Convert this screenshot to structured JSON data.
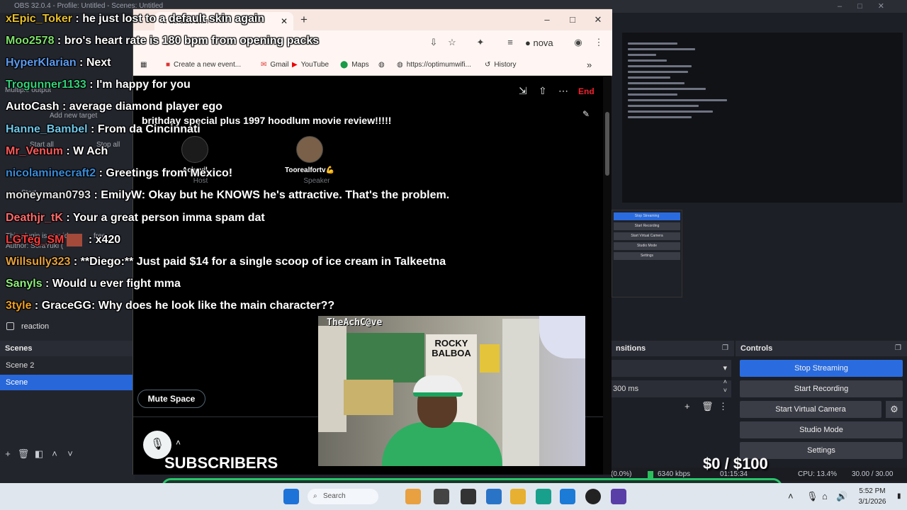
{
  "obs": {
    "title_bar": "OBS 32.0.4 - Profile: Untitled - Scenes: Untitled",
    "scenes_header": "Scenes",
    "scenes": [
      "Scene 2",
      "Scene"
    ],
    "active_scene": "Scene",
    "transitions_header": "nsitions",
    "transition_duration": "300 ms",
    "controls_header": "Controls",
    "controls": [
      "Stop Streaming",
      "Start Recording",
      "Start Virtual Camera",
      "Studio Mode",
      "Settings"
    ],
    "source_reaction": "reaction",
    "status": {
      "dropped": "(0.0%)",
      "bitrate": "6340 kbps",
      "time": "01:15:34",
      "cpu": "CPU: 13.4%",
      "fps": "30.00 / 30.00 FPS"
    },
    "ghost_texts": {
      "multiple_output": "Multiple output",
      "add_new_target": "Add new target",
      "start_all": "Start all",
      "stop_all": "Stop all",
      "plugin_notice": "This plugin is provide",
      "author": "Author: SoraYuki (",
      "free": "free",
      "host_label": "Host",
      "start": "Start"
    },
    "mini_controls": [
      "Stop Streaming",
      "Start Recording",
      "Start Virtual Camera",
      "Studio Mode",
      "Settings"
    ]
  },
  "browser": {
    "tab_title": "x  default skin",
    "bookmarks": [
      {
        "icon": "calendar-icon",
        "label": "Create a new event..."
      },
      {
        "icon": "gmail-icon",
        "label": "Gmail"
      },
      {
        "icon": "youtube-icon",
        "label": "YouTube"
      },
      {
        "icon": "maps-icon",
        "label": "Maps"
      },
      {
        "icon": "globe-icon",
        "label": ""
      },
      {
        "icon": "globe-icon",
        "label": "https://optimumwifi..."
      },
      {
        "icon": "history-icon",
        "label": "History"
      }
    ],
    "profile_name": "nova",
    "space": {
      "title": "brithday special plus 1997 hoodlum movie review!!!!!",
      "end_label": "End",
      "host_name": "Achavil",
      "host_role": "Host",
      "speaker_name": "Toorealfortv💪",
      "speaker_role": "Speaker",
      "mute_label": "Mute Space"
    }
  },
  "chat": [
    {
      "user": "xEpic_Toker",
      "color": "#e8c02a",
      "text": " : he just lost to a default skin again"
    },
    {
      "user": "Moo2578",
      "color": "#7ee06a",
      "text": " : bro's heart rate is 180 bpm from opening packs"
    },
    {
      "user": "HyperKlarian",
      "color": "#5b9bf0",
      "text": " : Next"
    },
    {
      "user": "Trogunner1133",
      "color": "#33d17a",
      "text": " : I'm happy for you"
    },
    {
      "user": "AutoCash",
      "color": "#ffffff",
      "text": " : average diamond player ego"
    },
    {
      "user": "Hanne_Bambel",
      "color": "#6fc7e8",
      "text": " : From da Cincinnati"
    },
    {
      "user": "Mr_Venum",
      "color": "#ff5a5a",
      "text": " : W Ach"
    },
    {
      "user": "nicolaminecraft2",
      "color": "#3a8bd8",
      "text": " : Greetings from Mexico!"
    },
    {
      "user": "moneyman0793",
      "color": "#e0e0e0",
      "text": " : EmilyW: Okay but he KNOWS he's attractive. That's the problem."
    },
    {
      "user": "Deathjr_tK",
      "color": "#ff6b6b",
      "text": " : Your a great person imma spam dat"
    },
    {
      "user": "LGTeg_SM",
      "color": "#ff3b3b",
      "text": " : x420"
    },
    {
      "user": "Willsully323",
      "color": "#e8a23a",
      "text": " : **Diego:** Just paid $14 for a single scoop of ice cream in Talkeetna"
    },
    {
      "user": "Sanyls",
      "color": "#8cf07a",
      "text": " : Would u ever fight mma"
    },
    {
      "user": "3tyle",
      "color": "#f0a020",
      "text": " : GraceGG: Why does he look like the main character??"
    }
  ],
  "webcam": {
    "label": "TheAchC@ve",
    "poster_text": "ROCKY BALBOA"
  },
  "overlay": {
    "subscribers_label": "SUBSCRIBERS",
    "goal_current": "$0",
    "goal_target": "/ $100"
  },
  "taskbar": {
    "search_placeholder": "Search",
    "time": "5:52 PM",
    "date": "3/1/2026"
  }
}
